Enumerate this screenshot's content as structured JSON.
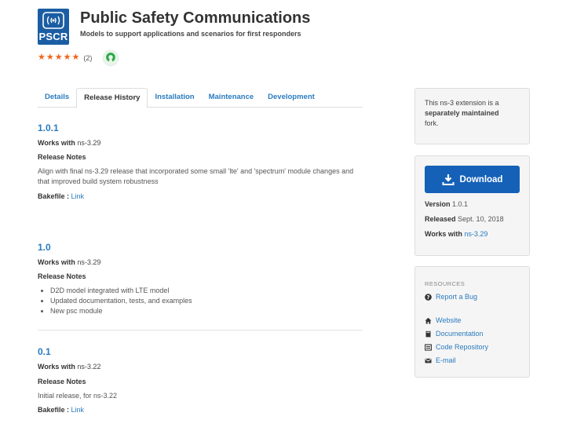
{
  "header": {
    "logo_text": "PSCR",
    "title": "Public Safety Communications",
    "subtitle": "Models to support applications and scenarios for first responders",
    "rating_stars": 5,
    "rating_count": "(2)",
    "open_source_icon": "open-source-icon"
  },
  "tabs": [
    {
      "label": "Details",
      "active": false
    },
    {
      "label": "Release History",
      "active": true
    },
    {
      "label": "Installation",
      "active": false
    },
    {
      "label": "Maintenance",
      "active": false
    },
    {
      "label": "Development",
      "active": false
    }
  ],
  "releases": [
    {
      "version": "1.0.1",
      "works_with_label": "Works with",
      "works_with": "ns-3.29",
      "notes_label": "Release Notes",
      "notes": "Align with final ns-3.29 release that incorporated some small 'lte' and 'spectrum' module changes and that improved build system robustness",
      "bakefile_label": "Bakefile :",
      "bakefile_link": "Link"
    },
    {
      "version": "1.0",
      "works_with_label": "Works with",
      "works_with": "ns-3.29",
      "notes_label": "Release Notes",
      "bullets": [
        "D2D model integrated with LTE model",
        "Updated documentation, tests, and examples",
        "New psc module"
      ]
    },
    {
      "version": "0.1",
      "works_with_label": "Works with",
      "works_with": "ns-3.22",
      "notes_label": "Release Notes",
      "notes": "Initial release, for ns-3.22",
      "bakefile_label": "Bakefile :",
      "bakefile_link": "Link"
    }
  ],
  "sidebar": {
    "extension_note_prefix": "This ns-3 extension is a ",
    "extension_note_bold": "separately maintained",
    "extension_note_suffix": "fork.",
    "download_label": "Download",
    "version_label": "Version",
    "version": "1.0.1",
    "released_label": "Released",
    "released": "Sept. 10, 2018",
    "works_with_label": "Works with",
    "works_with": "ns-3.29",
    "resources_title": "RESOURCES",
    "resources": [
      {
        "label": "Report a Bug",
        "icon": "question-circle-icon"
      },
      {
        "label": "Website",
        "icon": "home-icon"
      },
      {
        "label": "Documentation",
        "icon": "book-icon"
      },
      {
        "label": "Code Repository",
        "icon": "repository-icon"
      },
      {
        "label": "E-mail",
        "icon": "envelope-icon"
      }
    ]
  },
  "colors": {
    "link": "#2a7bbf",
    "star": "#f0651b",
    "download_button": "#1561b8",
    "logo_bg": "#1b5da3"
  }
}
